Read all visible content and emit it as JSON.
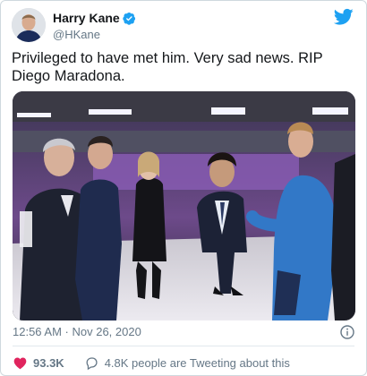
{
  "user": {
    "display_name": "Harry Kane",
    "handle": "@HKane",
    "verified": true
  },
  "tweet": {
    "text_line1": "Privileged to have met him. Very sad news. RIP",
    "text_line2": "Diego Maradona."
  },
  "meta": {
    "timestamp": "12:56 AM · Nov 26, 2020"
  },
  "stats": {
    "likes": "93.3K",
    "conversation": "4.8K people are Tweeting about this"
  },
  "icons": {
    "brand": "twitter-bird-icon",
    "verified": "verified-badge-icon",
    "info": "info-icon",
    "like": "heart-icon",
    "reply": "speech-bubble-icon"
  },
  "colors": {
    "brand": "#1da1f2",
    "like_red": "#e0245e",
    "muted": "#657786",
    "divider": "#e1e8ed"
  }
}
